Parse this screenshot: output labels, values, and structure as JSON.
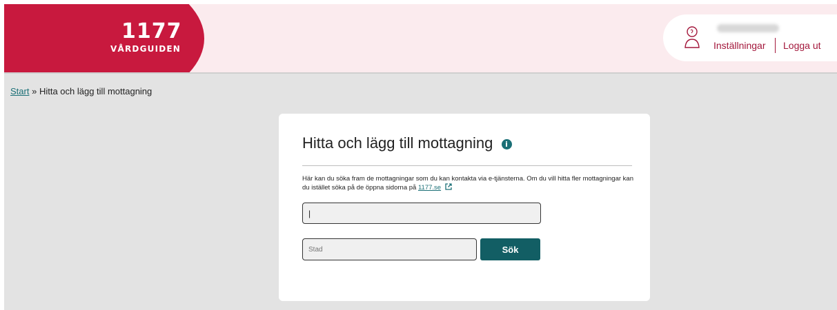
{
  "brand": {
    "number": "1177",
    "subtitle": "VÅRDGUIDEN",
    "color": "#c8193e"
  },
  "header": {
    "settings_label": "Inställningar",
    "logout_label": "Logga ut",
    "link_color": "#a3173b"
  },
  "breadcrumb": {
    "home_label": "Start",
    "separator": "»",
    "current_label": "Hitta och lägg till mottagning"
  },
  "card": {
    "title": "Hitta och lägg till mottagning",
    "info_icon": "info-icon",
    "description_part1": "Här kan du söka fram de mottagningar som du kan kontakta via e-tjänsterna. Om du vill hitta fler mottagningar kan du istället söka på de öppna sidorna på",
    "description_link": "1177.se",
    "external_icon": "external-link-icon",
    "search_value": "|",
    "city_placeholder": "Stad",
    "search_button": "Sök",
    "button_color": "#125e64"
  }
}
